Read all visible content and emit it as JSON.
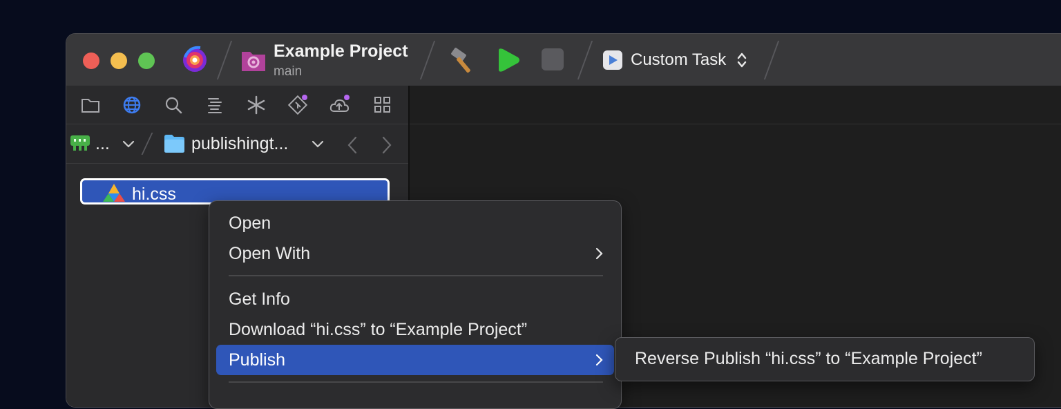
{
  "titlebar": {
    "project_title": "Example Project",
    "branch": "main",
    "task_label": "Custom Task"
  },
  "icons": {
    "app": "nova-logo-icon",
    "project": "project-gear-icon",
    "build": "hammer-icon",
    "run": "play-icon",
    "stop": "stop-icon",
    "task": "task-play-icon",
    "task_selector": "chevron-up-down-icon"
  },
  "sidebar": {
    "nav_icons": [
      "folder-icon",
      "globe-icon",
      "search-icon",
      "symbols-icon",
      "asterisk-icon",
      "git-icon",
      "cloud-icon",
      "grid-icon"
    ],
    "path": {
      "server_label": "...",
      "folder_label": "publishingt..."
    },
    "file": {
      "name": "hi.css"
    }
  },
  "context_menu": {
    "items": [
      {
        "label": "Open"
      },
      {
        "label": "Open With"
      },
      {
        "label": "Get Info"
      },
      {
        "label": "Download “hi.css” to “Example Project”"
      },
      {
        "label": "Publish"
      }
    ],
    "submenu": {
      "label": "Reverse Publish “hi.css” to “Example Project”"
    }
  },
  "colors": {
    "accent": "#2f56b8",
    "desktop": "#070c1d",
    "run_green": "#35c33a"
  }
}
